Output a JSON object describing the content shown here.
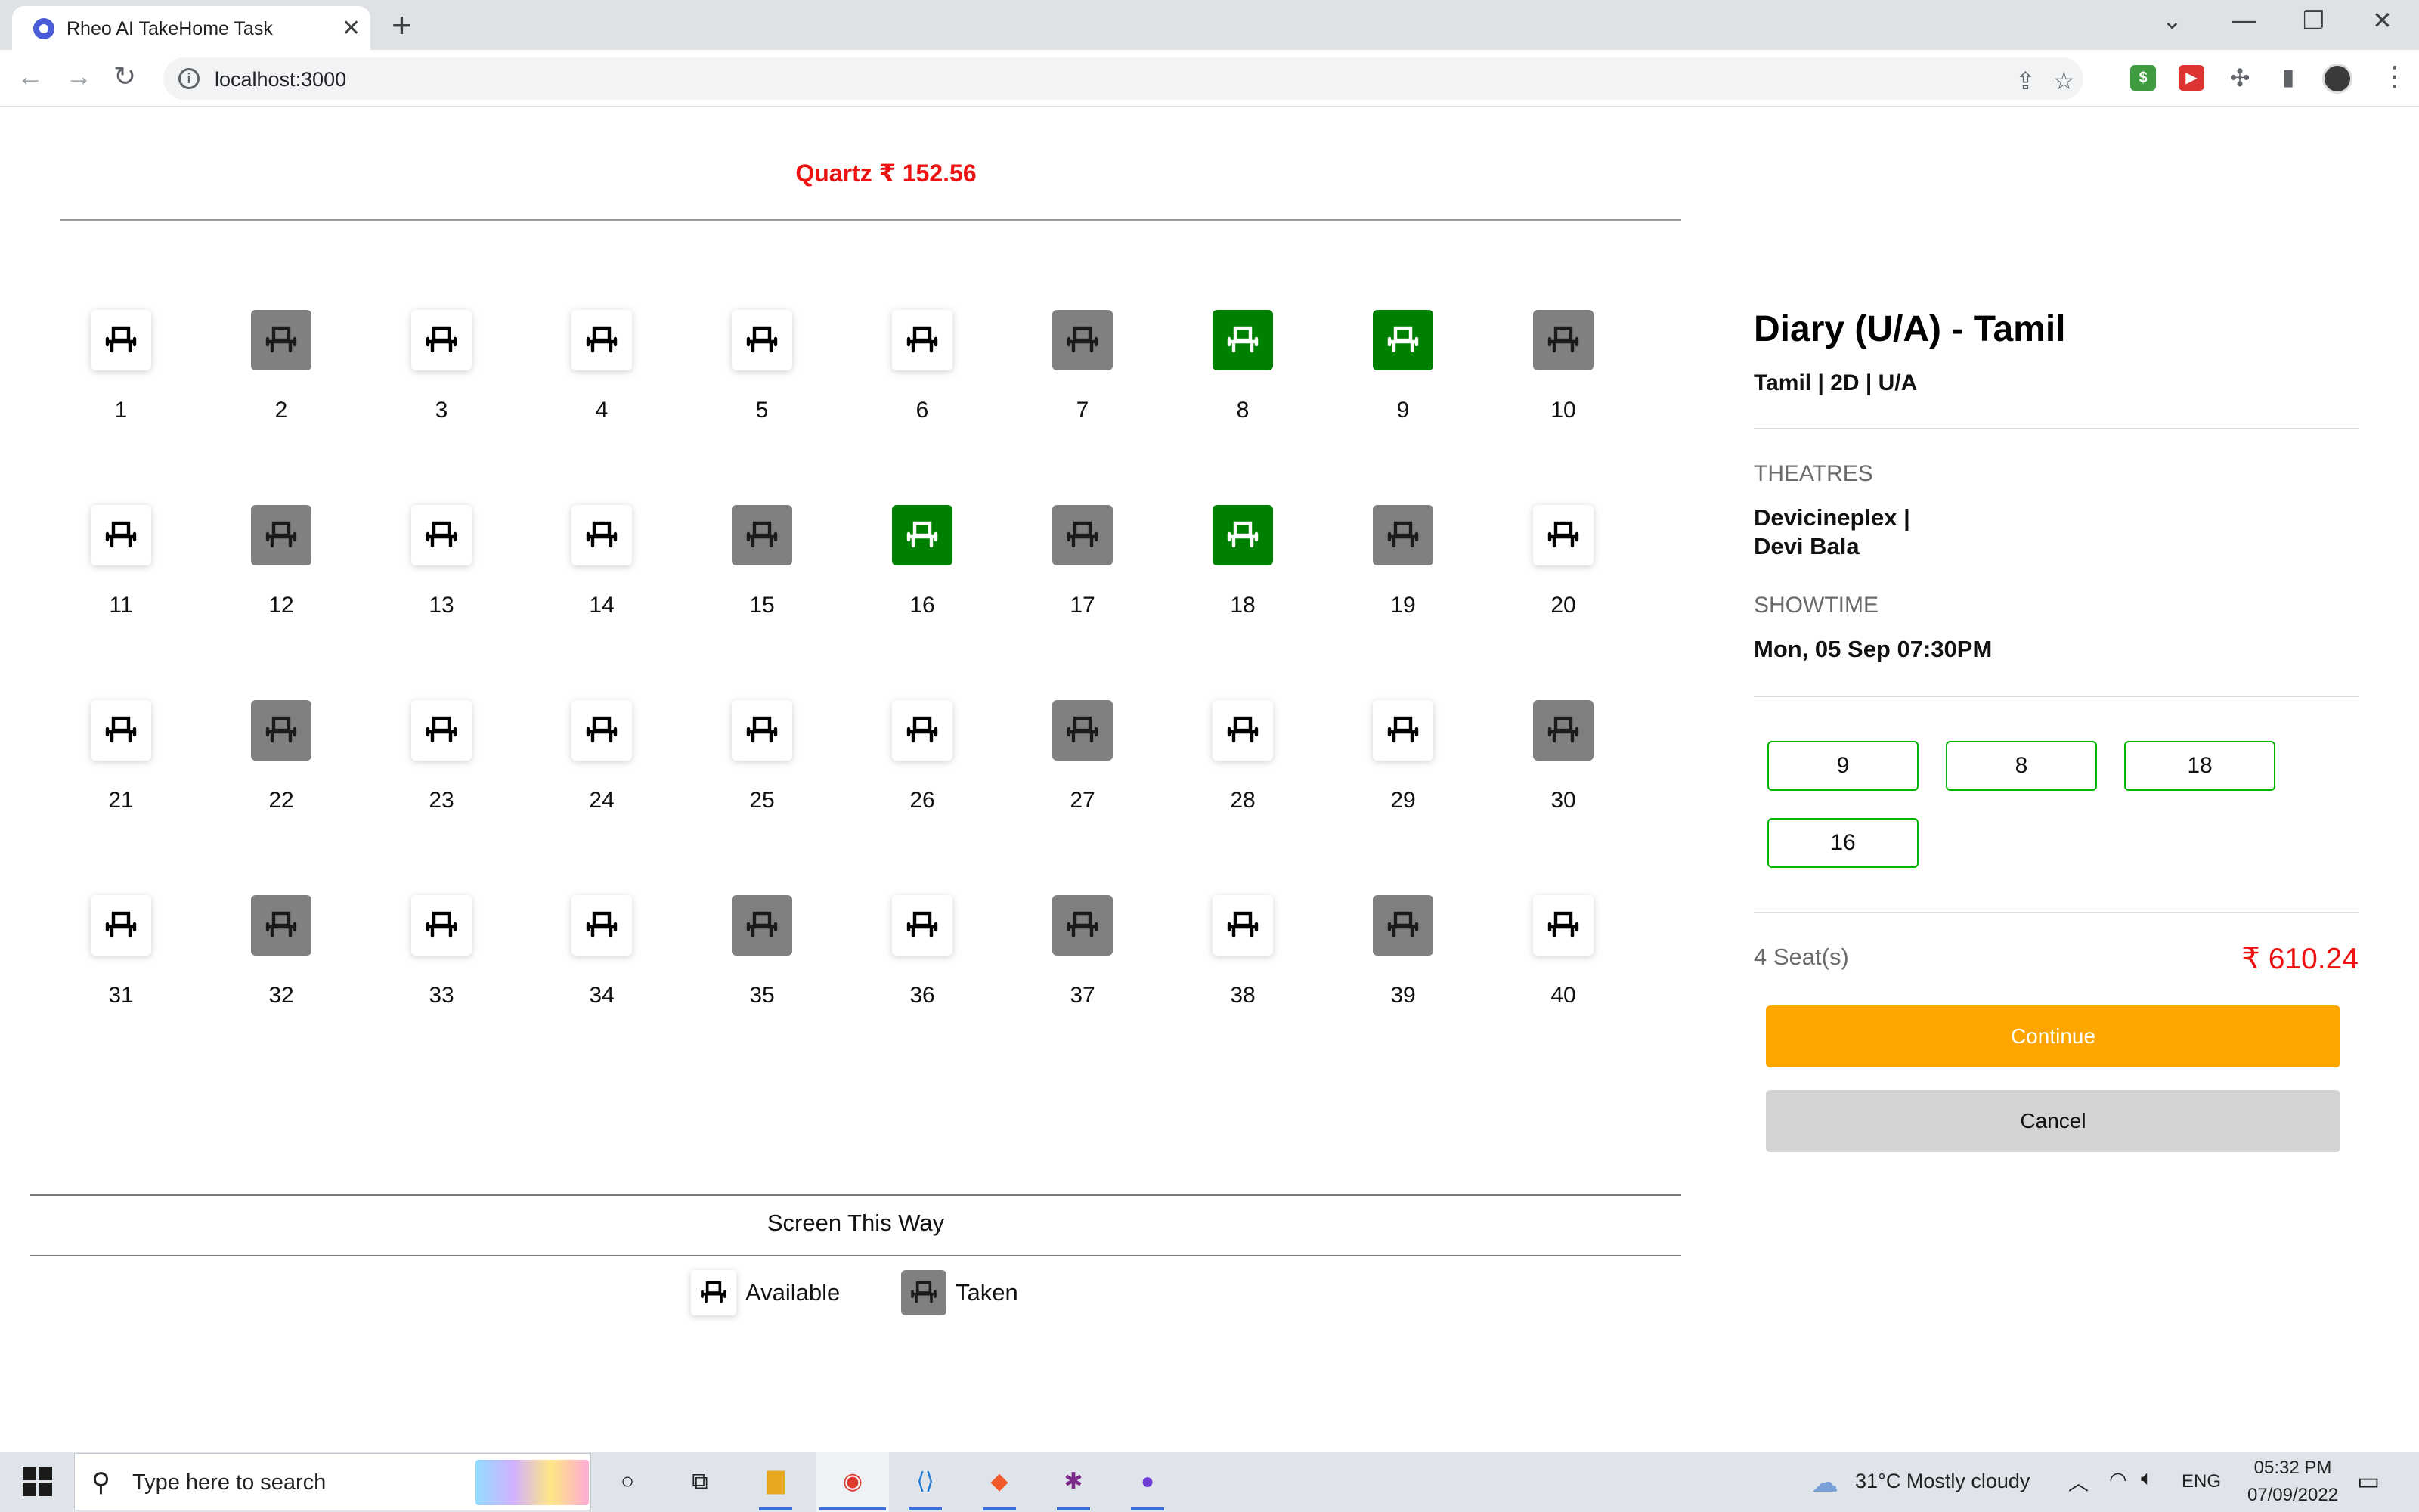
{
  "browser": {
    "tab_title": "Rheo AI TakeHome Task",
    "tab_close": "✕",
    "new_tab": "+",
    "url": "localhost:3000",
    "win_chevron": "⌄",
    "win_min": "—",
    "win_restore": "❐",
    "win_close": "✕",
    "ext_money": "$"
  },
  "header": {
    "price_line": "Quartz ₹ 152.56"
  },
  "seats": [
    {
      "n": "1",
      "s": "available"
    },
    {
      "n": "2",
      "s": "taken"
    },
    {
      "n": "3",
      "s": "available"
    },
    {
      "n": "4",
      "s": "available"
    },
    {
      "n": "5",
      "s": "available"
    },
    {
      "n": "6",
      "s": "available"
    },
    {
      "n": "7",
      "s": "taken"
    },
    {
      "n": "8",
      "s": "selected"
    },
    {
      "n": "9",
      "s": "selected"
    },
    {
      "n": "10",
      "s": "taken"
    },
    {
      "n": "11",
      "s": "available"
    },
    {
      "n": "12",
      "s": "taken"
    },
    {
      "n": "13",
      "s": "available"
    },
    {
      "n": "14",
      "s": "available"
    },
    {
      "n": "15",
      "s": "taken"
    },
    {
      "n": "16",
      "s": "selected"
    },
    {
      "n": "17",
      "s": "taken"
    },
    {
      "n": "18",
      "s": "selected"
    },
    {
      "n": "19",
      "s": "taken"
    },
    {
      "n": "20",
      "s": "available"
    },
    {
      "n": "21",
      "s": "available"
    },
    {
      "n": "22",
      "s": "taken"
    },
    {
      "n": "23",
      "s": "available"
    },
    {
      "n": "24",
      "s": "available"
    },
    {
      "n": "25",
      "s": "available"
    },
    {
      "n": "26",
      "s": "available"
    },
    {
      "n": "27",
      "s": "taken"
    },
    {
      "n": "28",
      "s": "available"
    },
    {
      "n": "29",
      "s": "available"
    },
    {
      "n": "30",
      "s": "taken"
    },
    {
      "n": "31",
      "s": "available"
    },
    {
      "n": "32",
      "s": "taken"
    },
    {
      "n": "33",
      "s": "available"
    },
    {
      "n": "34",
      "s": "available"
    },
    {
      "n": "35",
      "s": "taken"
    },
    {
      "n": "36",
      "s": "available"
    },
    {
      "n": "37",
      "s": "taken"
    },
    {
      "n": "38",
      "s": "available"
    },
    {
      "n": "39",
      "s": "taken"
    },
    {
      "n": "40",
      "s": "available"
    }
  ],
  "screen": {
    "label": "Screen This Way"
  },
  "legend": {
    "available": "Available",
    "taken": "Taken"
  },
  "movie": {
    "title": "Diary (U/A) - Tamil",
    "meta": "Tamil | 2D | U/A",
    "theatres_label": "THEATRES",
    "theatre_line1": "Devicineplex |",
    "theatre_line2": "Devi Bala",
    "showtime_label": "SHOWTIME",
    "showtime": "Mon, 05 Sep 07:30PM"
  },
  "selected_chips": [
    "9",
    "8",
    "18",
    "16"
  ],
  "summary": {
    "seat_count": "4 Seat(s)",
    "total": "₹ 610.24"
  },
  "actions": {
    "continue": "Continue",
    "cancel": "Cancel"
  },
  "taskbar": {
    "search_placeholder": "Type here to search",
    "weather": "31°C  Mostly cloudy",
    "lang": "ENG",
    "time": "05:32 PM",
    "date": "07/09/2022"
  },
  "colors": {
    "selected": "#008000",
    "taken": "#808080",
    "accent_price": "#ee1111",
    "continue": "#ffa500"
  }
}
